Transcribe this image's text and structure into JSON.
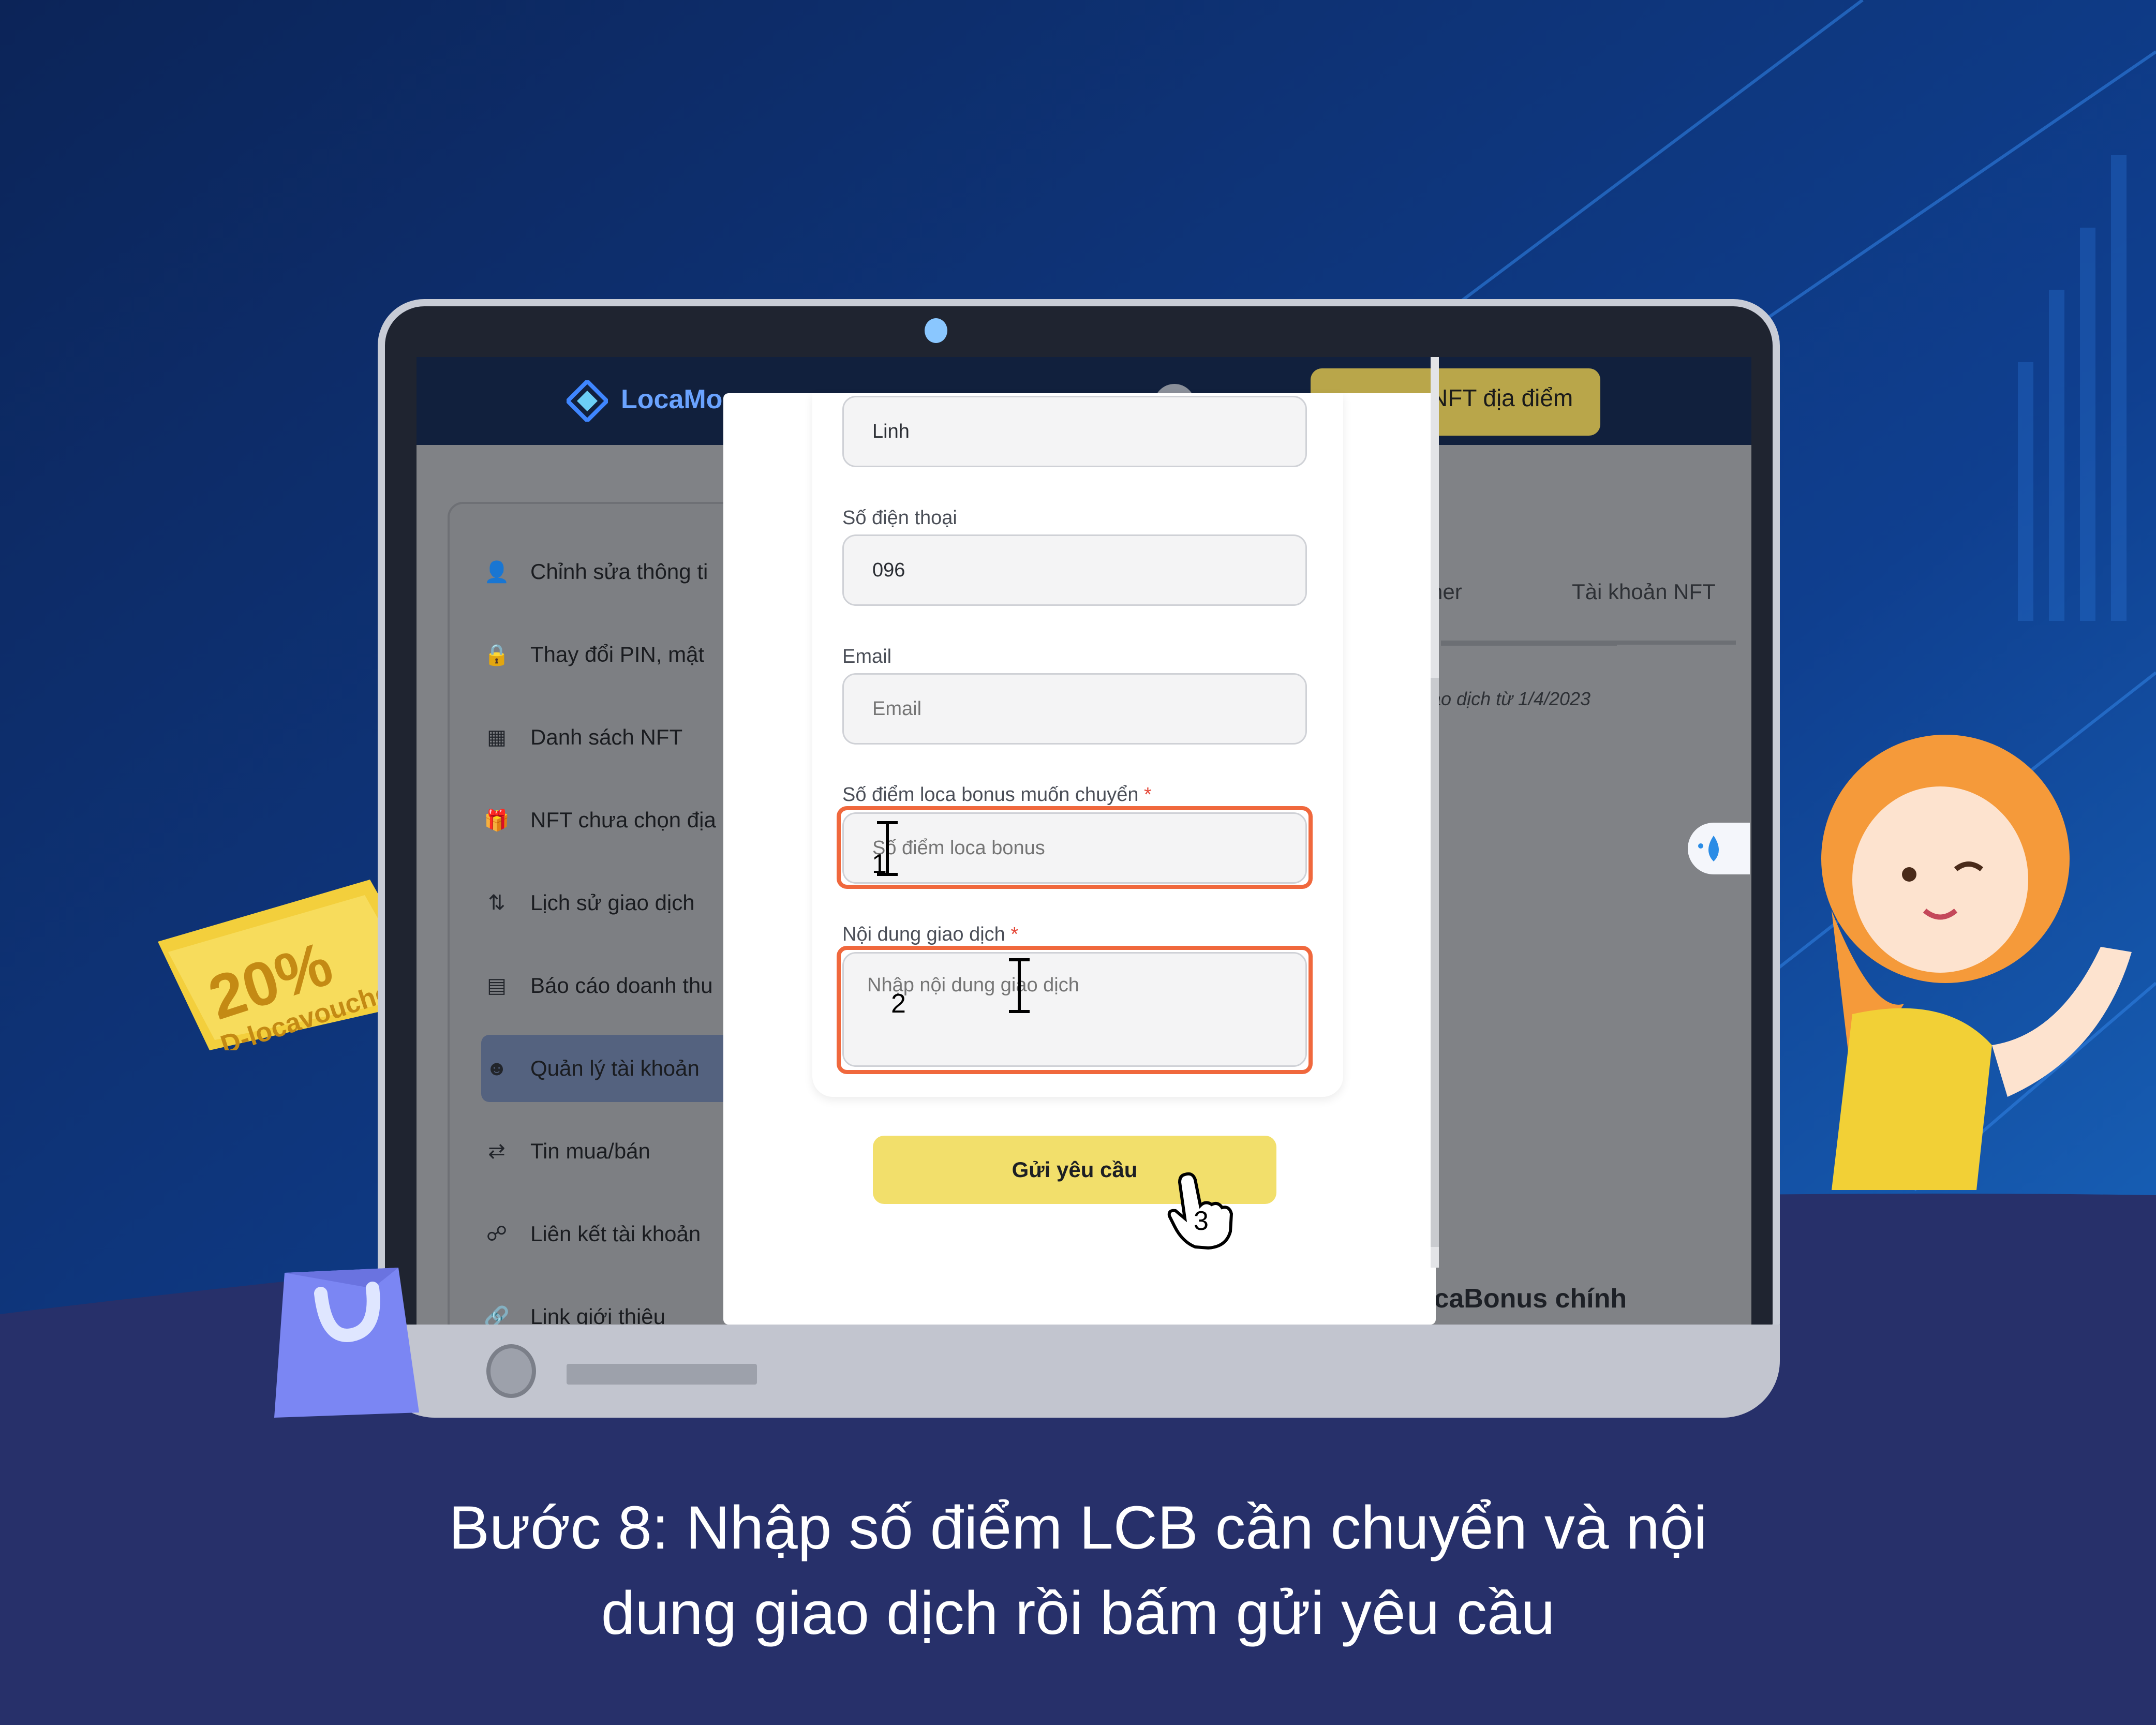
{
  "app": {
    "logo_text": "LocaMos",
    "nft_button_label": "NFT địa điểm"
  },
  "sidebar": {
    "items": [
      {
        "label": "Chỉnh sửa thông ti",
        "icon": "user-icon"
      },
      {
        "label": "Thay đổi PIN, mật",
        "icon": "lock-icon"
      },
      {
        "label": "Danh sách NFT",
        "icon": "list-icon"
      },
      {
        "label": "NFT chưa chọn địa",
        "icon": "gift-icon"
      },
      {
        "label": "Lịch sử giao dịch",
        "icon": "swap-vertical-icon"
      },
      {
        "label": "Báo cáo doanh thu",
        "icon": "report-icon"
      },
      {
        "label": "Quản lý tài khoản",
        "icon": "users-icon"
      },
      {
        "label": "Tin mua/bán",
        "icon": "swap-horizontal-icon"
      },
      {
        "label": "Liên kết tài khoản",
        "icon": "link-accounts-icon"
      },
      {
        "label": "Link giới thiệu",
        "icon": "link-icon"
      }
    ],
    "active_index": 6
  },
  "background": {
    "tab_partial": "ner",
    "tab_nft": "Tài khoản NFT",
    "note": "ao dịch từ 1/4/2023",
    "history_title": "Lịch sử biến động tài khoản LocaBonus chính"
  },
  "form": {
    "name_value": "Linh",
    "phone_label": "Số điện thoại",
    "phone_value": "096",
    "email_label": "Email",
    "email_placeholder": "Email",
    "points_label": "Số điểm loca bonus muốn chuyển",
    "points_placeholder": "Số điểm loca bonus",
    "content_label": "Nội dung giao dịch",
    "content_placeholder": "Nhập nội dung giao dịch",
    "required_mark": "*",
    "submit_label": "Gửi yêu cầu"
  },
  "annotations": {
    "step1": "1",
    "step2": "2",
    "step3": "3"
  },
  "decor": {
    "voucher_percent": "20%",
    "voucher_text": "D-locavouche"
  },
  "caption": {
    "line1": "Bước 8: Nhập số điểm LCB cần chuyển và nội",
    "line2": "dung giao dịch rồi bấm gửi yêu cầu"
  },
  "colors": {
    "background_top": "#0b2a66",
    "background_bottom": "#27306a",
    "highlight": "#f0683d",
    "submit_button": "#f2df6b",
    "header": "#11203d"
  }
}
